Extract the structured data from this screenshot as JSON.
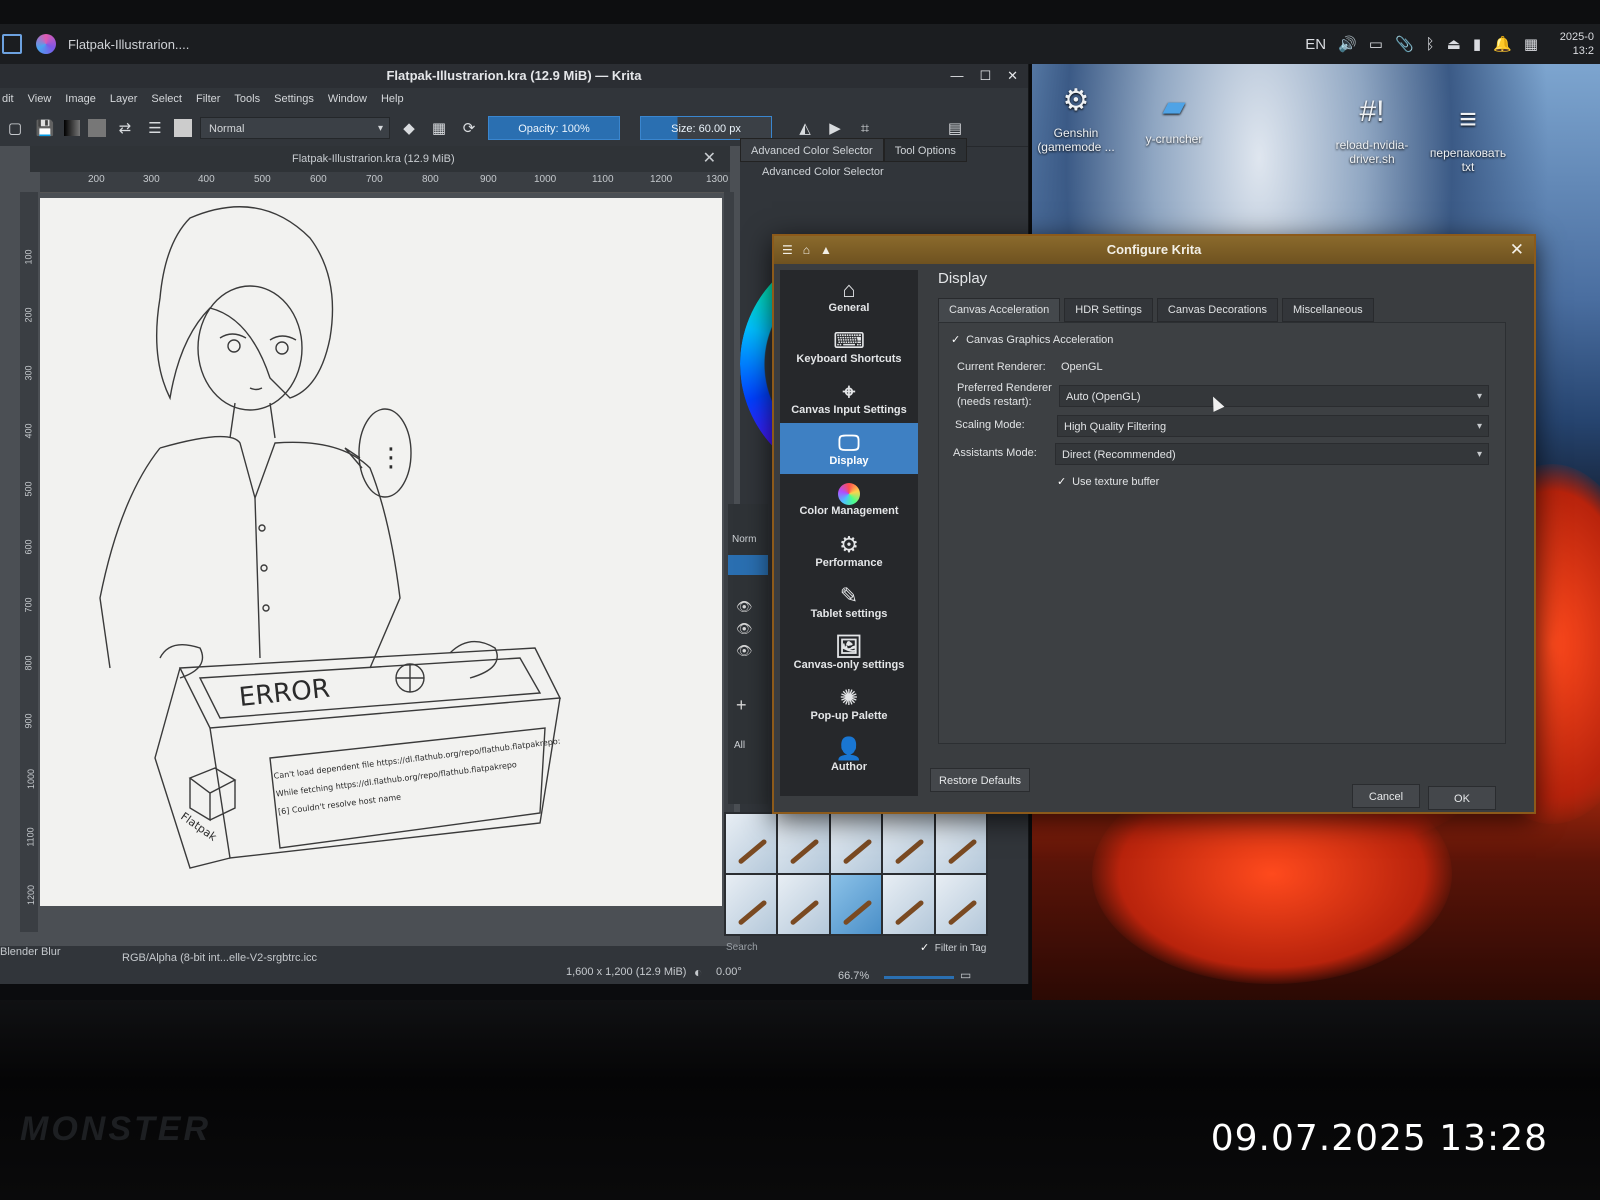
{
  "photo_timestamp": "09.07.2025 13:28",
  "laptop_brand": "MONSTER",
  "system_panel": {
    "task_title": "Flatpak-Illustrarion....",
    "tray": {
      "language": "EN",
      "clock_date": "2025-0",
      "clock_time": "13:2"
    }
  },
  "desktop_icons": [
    {
      "icon": "gear-icon",
      "label": "Genshin (gamemode ..."
    },
    {
      "icon": "folder-icon",
      "label": "y-cruncher"
    },
    {
      "icon": "script-icon",
      "label": "reload-nvidia-driver.sh"
    },
    {
      "icon": "text-file-icon",
      "label": "перепаковать txt"
    }
  ],
  "krita": {
    "window_title": "Flatpak-Illustrarion.kra (12.9 MiB) — Krita",
    "menu": [
      "dit",
      "View",
      "Image",
      "Layer",
      "Select",
      "Filter",
      "Tools",
      "Settings",
      "Window",
      "Help"
    ],
    "toolbar": {
      "blend_mode": "Normal",
      "opacity": "Opacity: 100%",
      "size": "Size: 60.00 px"
    },
    "doc_tab_title": "Flatpak-Illustrarion.kra (12.9 MiB)",
    "ruler_ticks": [
      "200",
      "300",
      "400",
      "500",
      "600",
      "700",
      "800",
      "900",
      "1000",
      "1100",
      "1200",
      "1300"
    ],
    "ruler_vertical_ticks": [
      "100",
      "200",
      "300",
      "400",
      "500",
      "600",
      "700",
      "800",
      "900",
      "1000",
      "1100",
      "1200"
    ],
    "illustration": {
      "box_error_word": "ERROR",
      "box_brand": "Flatpak",
      "box_label_line1": "Can't load dependent file https://dl.flathub.org/repo/flathub.flatpakrepo:",
      "box_label_line2": "While fetching https://dl.flathub.org/repo/flathub.flatpakrepo",
      "box_label_line3": "[6] Couldn't resolve host name",
      "speech_bubble": "⋮"
    },
    "dockers": {
      "tabs": [
        "Advanced Color Selector",
        "Tool Options"
      ],
      "subtitle": "Advanced Color Selector",
      "brush_search_placeholder": "Search",
      "filter_in_tag": "Filter in Tag",
      "layers_blend": "Norm",
      "brush_tag": "All"
    },
    "statusbar": {
      "brush_name": "Blender Blur",
      "color_profile": "RGB/Alpha (8-bit int...elle-V2-srgbtrc.icc",
      "image_size": "1,600 x 1,200 (12.9 MiB)",
      "rotation": "0.00°",
      "zoom": "66.7%"
    }
  },
  "configure_dialog": {
    "title": "Configure Krita",
    "sidebar": [
      {
        "label": "General",
        "icon": "home-icon"
      },
      {
        "label": "Keyboard Shortcuts",
        "icon": "keyboard-icon"
      },
      {
        "label": "Canvas Input Settings",
        "icon": "canvas-input-icon"
      },
      {
        "label": "Display",
        "icon": "monitor-icon"
      },
      {
        "label": "Color Management",
        "icon": "color-wheel-icon"
      },
      {
        "label": "Performance",
        "icon": "gears-icon"
      },
      {
        "label": "Tablet settings",
        "icon": "tablet-pen-icon"
      },
      {
        "label": "Canvas-only settings",
        "icon": "image-icon"
      },
      {
        "label": "Pop-up Palette",
        "icon": "palette-icon"
      },
      {
        "label": "Author",
        "icon": "person-icon"
      }
    ],
    "section_title": "Display",
    "tabs": [
      "Canvas Acceleration",
      "HDR Settings",
      "Canvas Decorations",
      "Miscellaneous"
    ],
    "canvas_graphics_acceleration": "Canvas Graphics Acceleration",
    "current_renderer_label": "Current Renderer:",
    "current_renderer_value": "OpenGL",
    "preferred_renderer_label": "Preferred Renderer (needs restart):",
    "preferred_renderer_value": "Auto (OpenGL)",
    "scaling_mode_label": "Scaling Mode:",
    "scaling_mode_value": "High Quality Filtering",
    "assistants_mode_label": "Assistants Mode:",
    "assistants_mode_value": "Direct (Recommended)",
    "use_texture_buffer": "Use texture buffer",
    "restore_defaults": "Restore Defaults",
    "cancel": "Cancel",
    "ok": "OK"
  }
}
